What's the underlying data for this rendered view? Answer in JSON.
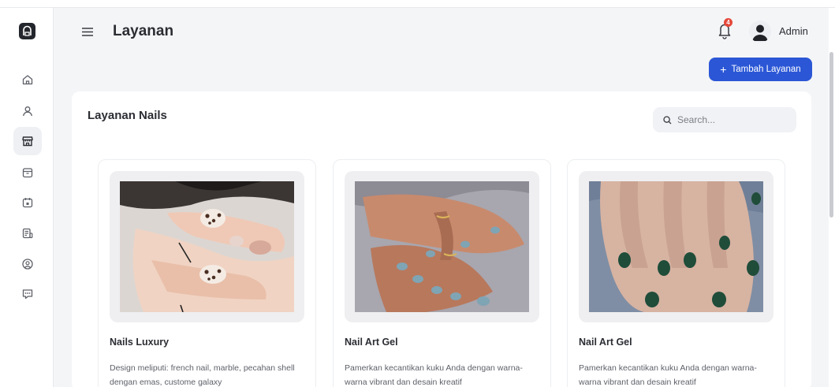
{
  "header": {
    "title": "Layanan",
    "user_name": "Admin",
    "notification_count": "4"
  },
  "actions": {
    "add_label": "Tambah Layanan"
  },
  "content": {
    "title": "Layanan Nails",
    "search_placeholder": "Search..."
  },
  "sidebar": {
    "items": [
      {
        "icon": "home-icon"
      },
      {
        "icon": "user-icon"
      },
      {
        "icon": "store-icon",
        "active": true
      },
      {
        "icon": "archive-icon"
      },
      {
        "icon": "calendar-icon"
      },
      {
        "icon": "report-icon"
      },
      {
        "icon": "user-circle-icon"
      },
      {
        "icon": "message-icon"
      }
    ]
  },
  "services": [
    {
      "name": "Nails Luxury",
      "description": "Design meliputi: french nail, marble, pecahan shell dengan emas, custome galaxy"
    },
    {
      "name": "Nail Art Gel",
      "description": "Pamerkan kecantikan kuku Anda dengan warna-warna vibrant dan desain kreatif"
    },
    {
      "name": "Nail Art Gel",
      "description": "Pamerkan kecantikan kuku Anda dengan warna-warna vibrant dan desain kreatif"
    }
  ],
  "colors": {
    "accent": "#2b57d6",
    "badge": "#e5483b",
    "sidebar_active": "#eef0f4"
  }
}
